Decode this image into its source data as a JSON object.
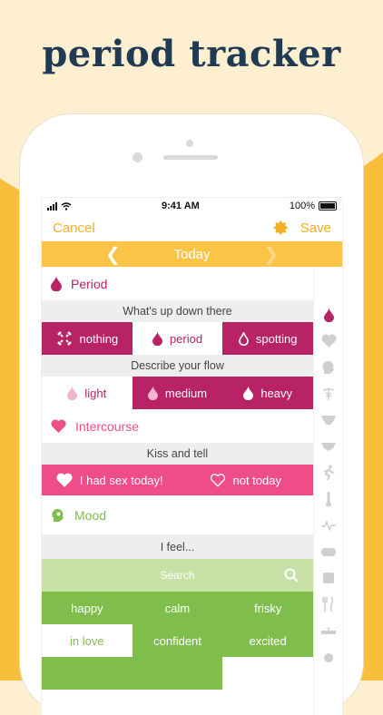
{
  "headline": "period tracker",
  "status": {
    "time": "9:41 AM",
    "battery": "100%"
  },
  "nav": {
    "cancel": "Cancel",
    "save": "Save"
  },
  "date": {
    "label": "Today"
  },
  "period": {
    "title": "Period",
    "subhead": "What's up down there",
    "options": [
      "nothing",
      "period",
      "spotting"
    ],
    "flow_subhead": "Describe your flow",
    "flow": [
      "light",
      "medium",
      "heavy"
    ]
  },
  "intercourse": {
    "title": "Intercourse",
    "subhead": "Kiss and tell",
    "options": [
      "I had sex today!",
      "not today"
    ]
  },
  "mood": {
    "title": "Mood",
    "subhead": "I feel...",
    "search_placeholder": "Search",
    "rows": [
      [
        "happy",
        "calm",
        "frisky"
      ],
      [
        "in love",
        "confident",
        "excited"
      ]
    ]
  },
  "colors": {
    "accent_yellow": "#fbc447",
    "magenta": "#b82366",
    "pink": "#ee4d88",
    "green": "#7fbd4c",
    "headline": "#1f3a52"
  },
  "icons": {
    "sidebar": [
      "drop-icon",
      "heart-icon",
      "head-icon",
      "caduceus-icon",
      "underwear-icon",
      "pad-icon",
      "runner-icon",
      "thermometer-icon",
      "pulse-icon",
      "sleep-icon",
      "scale-icon",
      "fork-knife-icon",
      "ruler-icon",
      "bottle-icon"
    ]
  }
}
